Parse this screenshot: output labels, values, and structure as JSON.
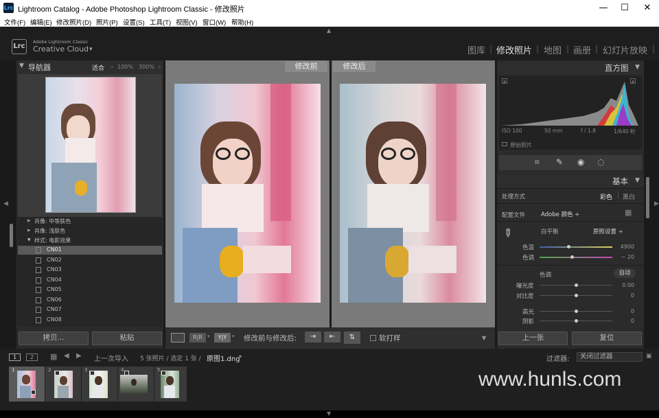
{
  "window": {
    "title": "Lightroom Catalog - Adobe Photoshop Lightroom Classic - 修改照片",
    "app_icon": "Lrc",
    "minimize": "—",
    "maximize": "☐",
    "close": "✕"
  },
  "menu": [
    "文件(F)",
    "编辑(E)",
    "修改照片(D)",
    "照片(P)",
    "设置(S)",
    "工具(T)",
    "视图(V)",
    "窗口(W)",
    "帮助(H)"
  ],
  "identity": {
    "logo": "Lrc",
    "line1": "Adobe Lightroom Classic",
    "line2": "Creative Cloud",
    "caret": "▾"
  },
  "modules": [
    "图库",
    "修改照片",
    "地图",
    "画册",
    "幻灯片放映"
  ],
  "active_module": "修改照片",
  "navigator": {
    "title": "导航器",
    "zoom": [
      "适合",
      "100%",
      "300%"
    ]
  },
  "presets": [
    {
      "label": "肖像: 中等肤色",
      "type": "folder"
    },
    {
      "label": "肖像: 浅肤色",
      "type": "folder"
    },
    {
      "label": "样式: 电影效果",
      "type": "folder-open"
    },
    {
      "label": "CN01",
      "type": "item",
      "selected": true
    },
    {
      "label": "CN02",
      "type": "item"
    },
    {
      "label": "CN03",
      "type": "item"
    },
    {
      "label": "CN04",
      "type": "item"
    },
    {
      "label": "CN05",
      "type": "item"
    },
    {
      "label": "CN06",
      "type": "item"
    },
    {
      "label": "CN07",
      "type": "item"
    },
    {
      "label": "CN08",
      "type": "item"
    }
  ],
  "left_buttons": {
    "copy": "拷贝...",
    "paste": "粘贴"
  },
  "compare": {
    "before": "修改前",
    "after": "修改后"
  },
  "toolbar": {
    "view_yy": "Y|Y",
    "label": "修改前与修改后:",
    "soft_proof": "软打样"
  },
  "histogram": {
    "title": "直方图",
    "iso": "ISO 100",
    "focal": "50 mm",
    "aperture": "f / 1.8",
    "shutter": "1/640 秒",
    "original": "原始照片"
  },
  "basic": {
    "title": "基本",
    "treatment_label": "处理方式",
    "color": "彩色",
    "bw": "黑白",
    "profile_label": "配置文件",
    "profile": "Adobe 颜色 ÷",
    "wb_label": "白平衡",
    "wb_value": "原照设置 ÷",
    "temp_label": "色温",
    "temp_value": "4900",
    "temp_pos": 0.4,
    "tint_label": "色调",
    "tint_value": "− 20",
    "tint_pos": 0.45,
    "tone_label": "色调",
    "auto": "自动",
    "exposure_label": "曝光度",
    "exposure_value": "0.00",
    "exposure_pos": 0.5,
    "contrast_label": "对比度",
    "contrast_value": "0",
    "contrast_pos": 0.5,
    "highlights_label": "高光",
    "highlights_value": "0",
    "highlights_pos": 0.5,
    "shadows_label": "阴影",
    "shadows_value": "0",
    "shadows_pos": 0.5
  },
  "right_buttons": {
    "prev": "上一张",
    "reset": "复位"
  },
  "filmstrip_bar": {
    "screen1": "1",
    "screen2": "2",
    "source": "上一次导入",
    "count": "5 张照片 / 选定 1 张 /",
    "file": "原图1.dng",
    "filter_label": "过滤器:",
    "filter_value": "关闭过滤器"
  },
  "filmstrip": [
    "1",
    "2",
    "3",
    "4",
    "5"
  ],
  "watermark": "www.hunls.com",
  "colors": {
    "accent": "#3a3a3a",
    "panel": "#2b2b2b",
    "center_bg": "#7c7c7c"
  }
}
